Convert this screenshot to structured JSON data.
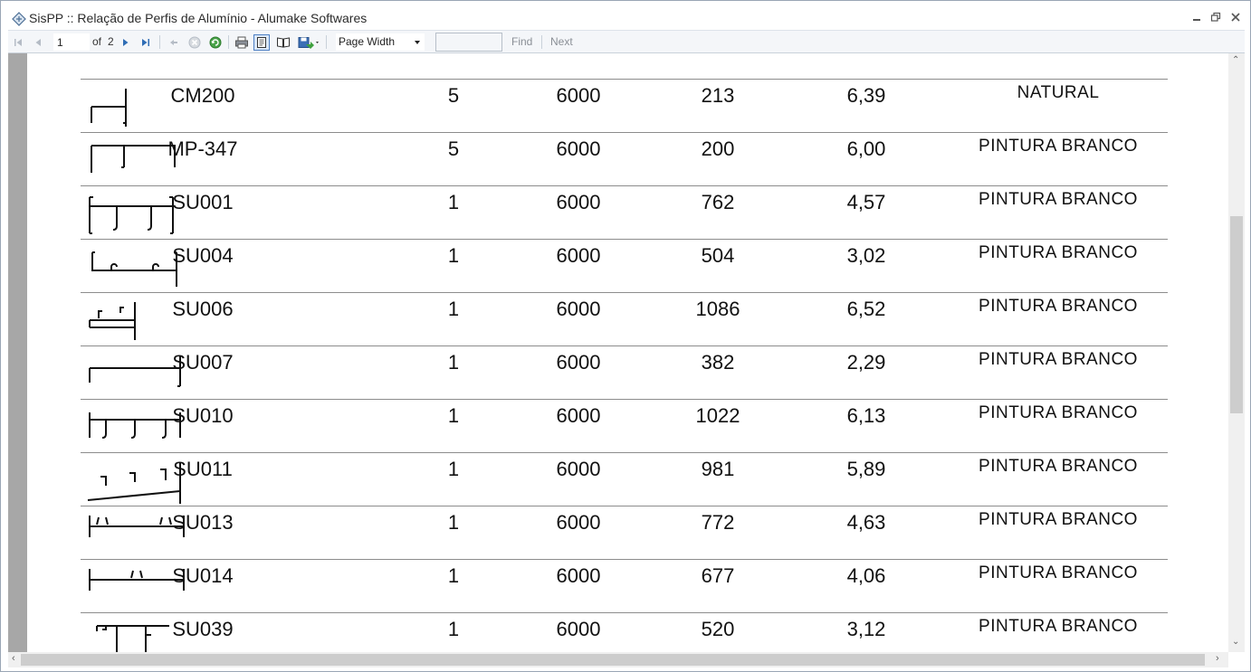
{
  "window": {
    "title": "SisPP :: Relação de Perfis de Alumínio - Alumake Softwares"
  },
  "toolbar": {
    "page_value": "1",
    "of_label": "of",
    "total_pages": "2",
    "zoom_value": "Page Width",
    "find_label": "Find",
    "next_label": "Next",
    "find_placeholder": ""
  },
  "rows": [
    {
      "code": "CM200",
      "qty": "5",
      "length": "6000",
      "weight": "213",
      "kg": "6,39",
      "finish": "NATURAL",
      "profile_icon": "cm200-profile-icon"
    },
    {
      "code": "MP-347",
      "qty": "5",
      "length": "6000",
      "weight": "200",
      "kg": "6,00",
      "finish": "PINTURA BRANCO",
      "profile_icon": "mp347-profile-icon"
    },
    {
      "code": "SU001",
      "qty": "1",
      "length": "6000",
      "weight": "762",
      "kg": "4,57",
      "finish": "PINTURA BRANCO",
      "profile_icon": "su001-profile-icon"
    },
    {
      "code": "SU004",
      "qty": "1",
      "length": "6000",
      "weight": "504",
      "kg": "3,02",
      "finish": "PINTURA BRANCO",
      "profile_icon": "su004-profile-icon"
    },
    {
      "code": "SU006",
      "qty": "1",
      "length": "6000",
      "weight": "1086",
      "kg": "6,52",
      "finish": "PINTURA BRANCO",
      "profile_icon": "su006-profile-icon"
    },
    {
      "code": "SU007",
      "qty": "1",
      "length": "6000",
      "weight": "382",
      "kg": "2,29",
      "finish": "PINTURA BRANCO",
      "profile_icon": "su007-profile-icon"
    },
    {
      "code": "SU010",
      "qty": "1",
      "length": "6000",
      "weight": "1022",
      "kg": "6,13",
      "finish": "PINTURA BRANCO",
      "profile_icon": "su010-profile-icon"
    },
    {
      "code": "SU011",
      "qty": "1",
      "length": "6000",
      "weight": "981",
      "kg": "5,89",
      "finish": "PINTURA BRANCO",
      "profile_icon": "su011-profile-icon"
    },
    {
      "code": "SU013",
      "qty": "1",
      "length": "6000",
      "weight": "772",
      "kg": "4,63",
      "finish": "PINTURA BRANCO",
      "profile_icon": "su013-profile-icon"
    },
    {
      "code": "SU014",
      "qty": "1",
      "length": "6000",
      "weight": "677",
      "kg": "4,06",
      "finish": "PINTURA BRANCO",
      "profile_icon": "su014-profile-icon"
    },
    {
      "code": "SU039",
      "qty": "1",
      "length": "6000",
      "weight": "520",
      "kg": "3,12",
      "finish": "PINTURA BRANCO",
      "profile_icon": "su039-profile-icon"
    }
  ]
}
